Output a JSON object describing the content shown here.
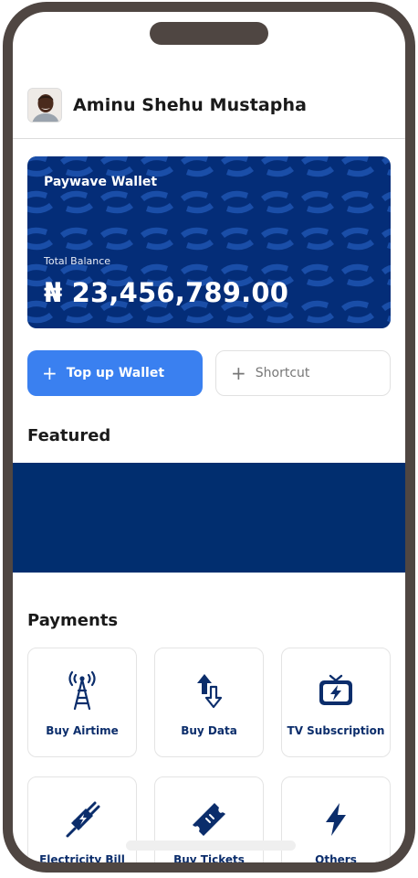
{
  "user": {
    "name": "Aminu Shehu Mustapha"
  },
  "wallet": {
    "title": "Paywave Wallet",
    "balance_label": "Total Balance",
    "balance": "₦ 23,456,789.00"
  },
  "actions": {
    "topup_label": "Top up Wallet",
    "shortcut_label": "Shortcut",
    "plus_glyph": "+"
  },
  "sections": {
    "featured": "Featured",
    "payments": "Payments"
  },
  "payments": [
    {
      "label": "Buy Airtime",
      "icon": "tower-icon"
    },
    {
      "label": "Buy Data",
      "icon": "data-transfer-icon"
    },
    {
      "label": "TV Subscription",
      "icon": "tv-icon"
    },
    {
      "label": "Electricity Bill",
      "icon": "plug-icon"
    },
    {
      "label": "Buy Tickets",
      "icon": "ticket-icon"
    },
    {
      "label": "Others",
      "icon": "bolt-icon"
    }
  ],
  "colors": {
    "brand_navy": "#042d78",
    "accent_blue": "#3a80f0",
    "frame": "#4f4642"
  }
}
